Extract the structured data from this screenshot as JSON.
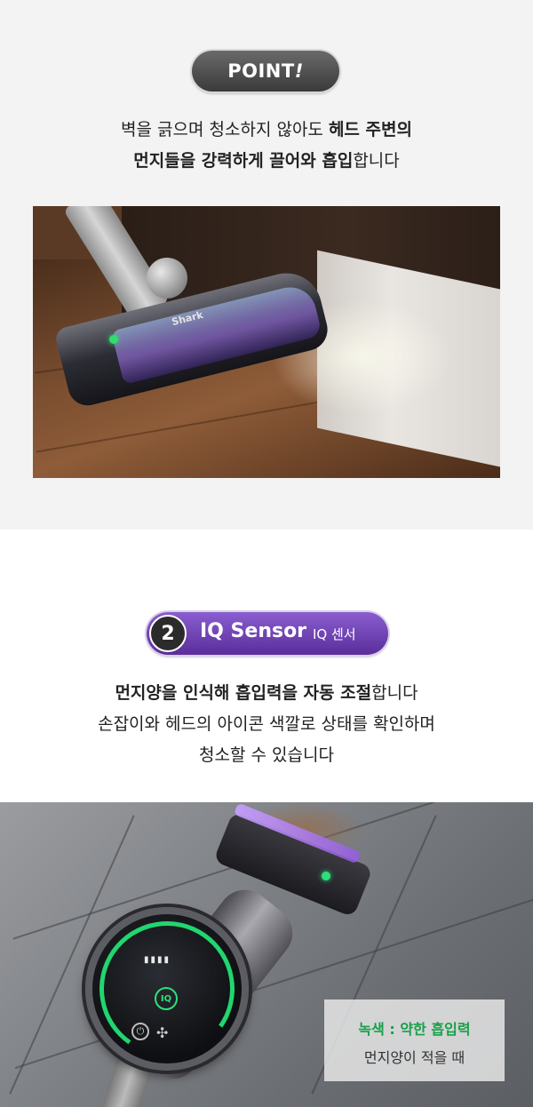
{
  "section1": {
    "badge": {
      "main": "POINT",
      "bang": "!"
    },
    "line1": {
      "normal": "벽을 긁으며 청소하지 않아도 ",
      "bold": "헤드 주변의"
    },
    "line2": {
      "bold": "먼지들을 강력하게 끌어와 흡입",
      "normal": "합니다"
    },
    "photo_brand": "Shark"
  },
  "section2": {
    "badge": {
      "number": "2",
      "title": "IQ Sensor",
      "subtitle": "IQ 센서"
    },
    "line1": {
      "bold": "먼지양을 인식해 흡입력을 자동 조절",
      "normal": "합니다"
    },
    "line2": "손잡이와 헤드의 아이콘 색깔로 상태를 확인하며",
    "line3": "청소할 수 있습니다",
    "display": {
      "bars": "▮▮▮▮",
      "iq_icon": "IQ",
      "power_icon": "power-icon",
      "fan_icon": "fan-icon"
    },
    "label": {
      "green": "녹색 : 약한 흡입력",
      "dark": "먼지양이 적을 때"
    }
  },
  "colors": {
    "accent_purple": "#6a3db0",
    "status_green": "#18a048",
    "badge_gray": "#4a4a4a"
  }
}
